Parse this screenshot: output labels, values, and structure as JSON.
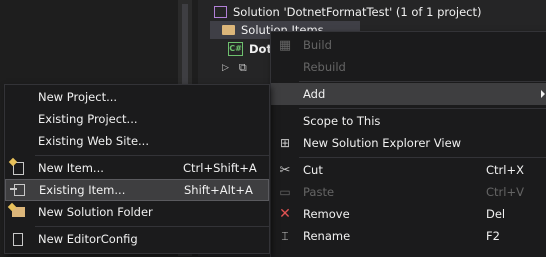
{
  "explorer": {
    "solution_label": "Solution 'DotnetFormatTest' (1 of 1 project)",
    "solution_items_label": "Solution Items",
    "project_label": "Dot",
    "cs_badge": "C#",
    "colors": {
      "background": "#252526",
      "selected_row": "#3f3f46",
      "solution_icon": "#b180d7",
      "folder_icon": "#dcb67a",
      "cs_icon": "#6ec06e"
    }
  },
  "context_menu": {
    "items": [
      {
        "label": "Build",
        "shortcut": "",
        "icon": "build-icon",
        "disabled": true
      },
      {
        "label": "Rebuild",
        "shortcut": "",
        "icon": "",
        "disabled": true
      },
      {
        "label": "Add",
        "shortcut": "",
        "icon": "",
        "disabled": false,
        "submenu": true,
        "highlighted": true
      },
      {
        "label": "Scope to This",
        "shortcut": "",
        "icon": "",
        "disabled": false
      },
      {
        "label": "New Solution Explorer View",
        "shortcut": "",
        "icon": "new-explorer-view-icon",
        "disabled": false
      },
      {
        "label": "Cut",
        "shortcut": "Ctrl+X",
        "icon": "cut-icon",
        "disabled": false
      },
      {
        "label": "Paste",
        "shortcut": "Ctrl+V",
        "icon": "paste-icon",
        "disabled": true
      },
      {
        "label": "Remove",
        "shortcut": "Del",
        "icon": "remove-icon",
        "disabled": false
      },
      {
        "label": "Rename",
        "shortcut": "F2",
        "icon": "rename-icon",
        "disabled": false
      }
    ]
  },
  "add_submenu": {
    "items": [
      {
        "label": "New Project...",
        "shortcut": ""
      },
      {
        "label": "Existing Project...",
        "shortcut": ""
      },
      {
        "label": "Existing Web Site...",
        "shortcut": ""
      },
      {
        "label": "New Item...",
        "shortcut": "Ctrl+Shift+A",
        "icon": "new-item-icon"
      },
      {
        "label": "Existing Item...",
        "shortcut": "Shift+Alt+A",
        "icon": "existing-item-icon",
        "highlighted": true
      },
      {
        "label": "New Solution Folder",
        "shortcut": "",
        "icon": "new-folder-icon"
      },
      {
        "label": "New EditorConfig",
        "shortcut": "",
        "icon": "editorconfig-icon"
      }
    ]
  },
  "colors": {
    "menu_background": "#1b1b1c",
    "menu_highlight": "#3e3e40",
    "menu_text": "#f1f1f1",
    "menu_disabled_text": "#656565",
    "remove_icon": "#e05252"
  }
}
